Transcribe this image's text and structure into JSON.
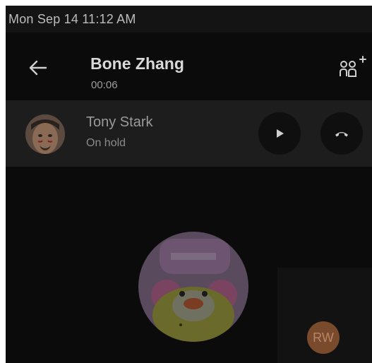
{
  "status_bar": {
    "datetime": "Mon Sep 14  11:12 AM"
  },
  "header": {
    "back_icon": "arrow-left-icon",
    "caller_name": "Bone Zhang",
    "call_duration": "00:06",
    "add_participant_icon": "add-participant-icon"
  },
  "held_call": {
    "name": "Tony Stark",
    "status": "On hold",
    "resume_icon": "play-icon",
    "hangup_icon": "hangup-icon"
  },
  "self_view": {
    "initials": "RW"
  },
  "colors": {
    "background": "#0b0b0b",
    "held_bar": "#1d1d1d",
    "status_bar": "#141414",
    "self_avatar": "#7a4a2d"
  }
}
